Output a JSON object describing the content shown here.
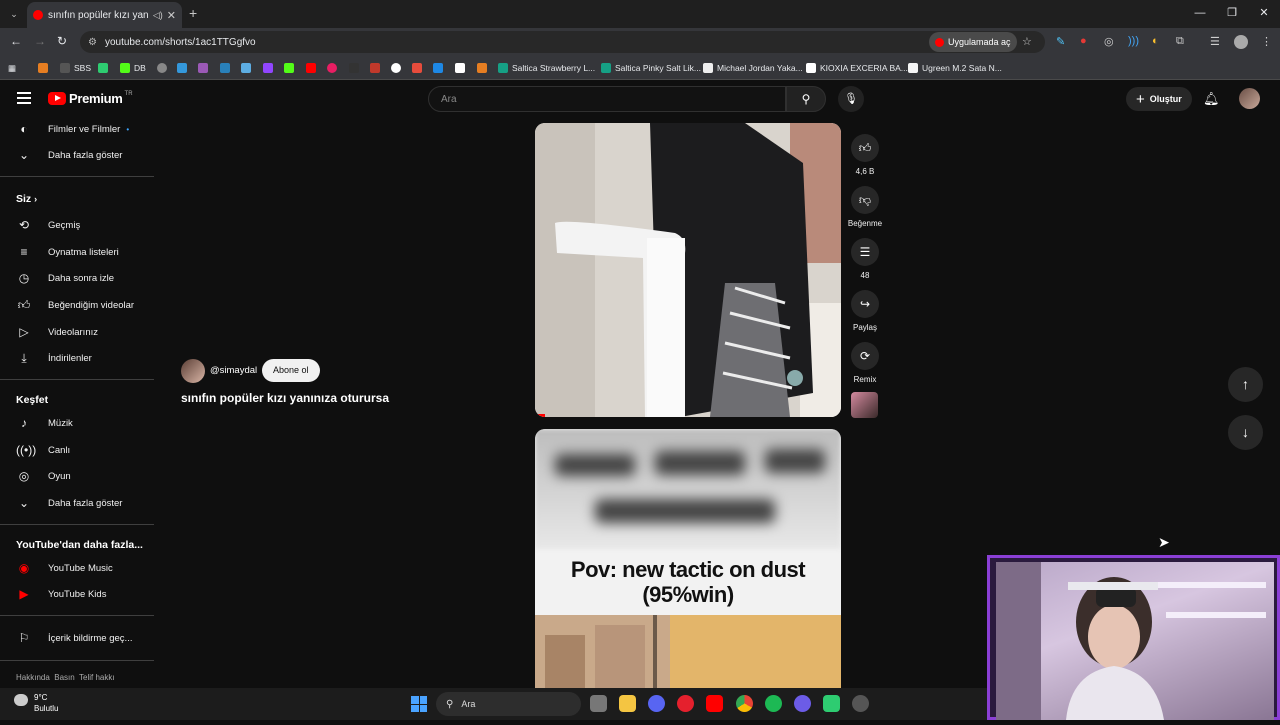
{
  "browser": {
    "tab_title": "sınıfın popüler kızı yanınıza",
    "url": "youtube.com/shorts/1ac1TTGgfvo",
    "open_in_app": "Uygulamada aç",
    "bookmarks": [
      "SBS",
      "DB",
      "Saltica Strawberry L...",
      "Saltica Pinky Salt Lik...",
      "Michael Jordan Yaka...",
      "KIOXIA EXCERIA BA...",
      "Ugreen M.2 Sata N..."
    ]
  },
  "header": {
    "logo": "Premium",
    "logo_country": "TR",
    "search_placeholder": "Ara",
    "create_label": "Oluştur"
  },
  "sidebar": {
    "top_items": [
      {
        "label": "Filmler ve Filmler",
        "icon": "film-icon"
      },
      {
        "label": "Daha fazla göster",
        "icon": "chevron-down-icon"
      }
    ],
    "you_heading": "Siz",
    "you_items": [
      {
        "label": "Geçmiş",
        "icon": "history-icon"
      },
      {
        "label": "Oynatma listeleri",
        "icon": "playlist-icon"
      },
      {
        "label": "Daha sonra izle",
        "icon": "clock-icon"
      },
      {
        "label": "Beğendiğim videolar",
        "icon": "thumbs-up-icon"
      },
      {
        "label": "Videolarınız",
        "icon": "video-icon"
      },
      {
        "label": "İndirilenler",
        "icon": "download-icon"
      }
    ],
    "explore_heading": "Keşfet",
    "explore_items": [
      {
        "label": "Müzik",
        "icon": "music-icon"
      },
      {
        "label": "Canlı",
        "icon": "live-icon"
      },
      {
        "label": "Oyun",
        "icon": "gaming-icon"
      },
      {
        "label": "Daha fazla göster",
        "icon": "chevron-down-icon"
      }
    ],
    "more_heading": "YouTube'dan daha fazla...",
    "more_items": [
      {
        "label": "YouTube Music",
        "icon": "youtube-music-icon"
      },
      {
        "label": "YouTube Kids",
        "icon": "youtube-kids-icon"
      }
    ],
    "report_item": "İçerik bildirme geç...",
    "footer": [
      "Hakkında",
      "Basın",
      "Telif hakkı"
    ]
  },
  "short": {
    "channel": "@simaydal",
    "subscribe": "Abone ol",
    "title": "sınıfın popüler kızı yanınıza oturursa",
    "likes": "4,6 B",
    "dislike_label": "Beğenme",
    "comments": "48",
    "share_label": "Paylaş",
    "remix_label": "Remix"
  },
  "next_short": {
    "overlay_text_line1": "Pov: new tactic on dust",
    "overlay_text_line2": "(95%win)"
  },
  "taskbar": {
    "temp": "9°C",
    "weather": "Bulutlu",
    "search": "Ara"
  }
}
